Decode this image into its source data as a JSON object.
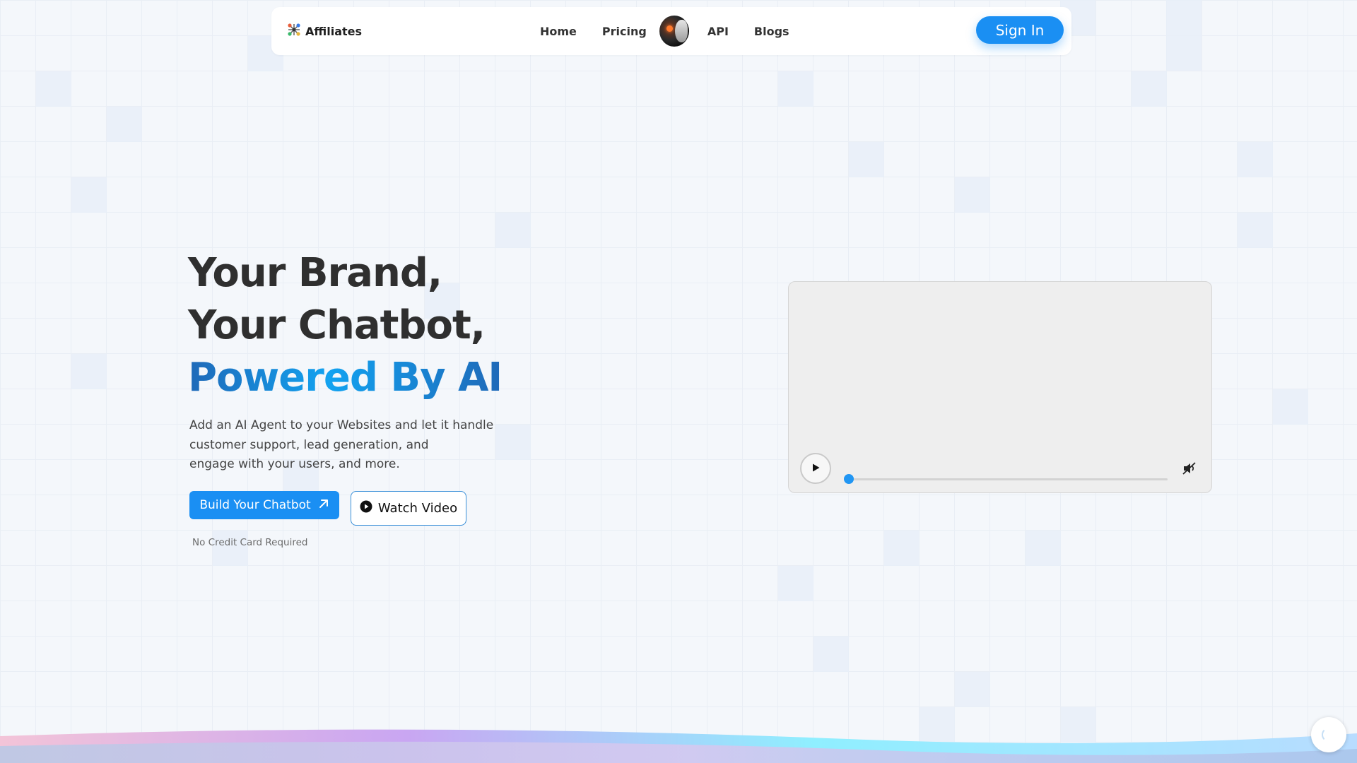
{
  "navbar": {
    "brand_name": "Affiliates",
    "links": [
      {
        "label": "Home"
      },
      {
        "label": "Pricing"
      },
      {
        "label": "API"
      },
      {
        "label": "Blogs"
      }
    ],
    "signin_label": "Sign In"
  },
  "hero": {
    "title_line1": "Your Brand,",
    "title_line2": "Your Chatbot,",
    "title_line3": "Powered By AI",
    "description_lines": [
      "Add an AI Agent to your Websites and let it handle",
      "customer support, lead generation, and",
      "engage with your users, and more."
    ],
    "primary_button": "Build Your Chatbot",
    "secondary_button": "Watch Video",
    "note": "No Credit Card Required"
  },
  "video": {
    "progress_fraction": 0.01,
    "muted": true
  },
  "colors": {
    "accent": "#1a8ff3",
    "title_gradient_dark": "#1f69b8",
    "title_gradient_light": "#12a2f0",
    "background": "#f4f7fb"
  },
  "icons": {
    "brand": "grid-nodes-icon",
    "build": "arrow-up-right-icon",
    "watch": "play-circle-icon",
    "play": "play-icon",
    "mute": "speaker-muted-icon",
    "loader": "spinner-icon"
  }
}
